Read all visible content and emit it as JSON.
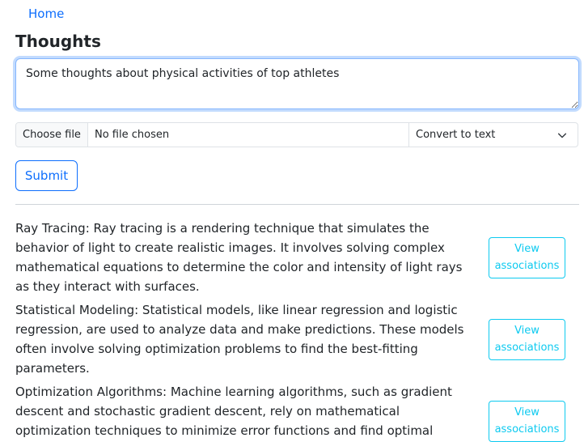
{
  "breadcrumb": {
    "home_label": "Home"
  },
  "page": {
    "title": "Thoughts"
  },
  "thought_form": {
    "text_value": "Some thoughts about physical activities of top athletes",
    "choose_file_label": "Choose file",
    "file_status": "No file chosen",
    "conversion_selected": "Convert to text",
    "submit_label": "Submit"
  },
  "thoughts": [
    {
      "text": "Ray Tracing: Ray tracing is a rendering technique that simulates the behavior of light to create realistic images. It involves solving complex mathematical equations to determine the color and intensity of light rays as they interact with surfaces.",
      "action_label": "View associations"
    },
    {
      "text": "Statistical Modeling: Statistical models, like linear regression and logistic regression, are used to analyze data and make predictions. These models often involve solving optimization problems to find the best-fitting parameters.",
      "action_label": "View associations"
    },
    {
      "text": "Optimization Algorithms: Machine learning algorithms, such as gradient descent and stochastic gradient descent, rely on mathematical optimization techniques to minimize error functions and find optimal parameter values.",
      "action_label": "View associations"
    }
  ],
  "colors": {
    "primary": "#0d6efd",
    "info": "#0dcaf0",
    "text": "#212529",
    "border": "#dee2e6"
  }
}
